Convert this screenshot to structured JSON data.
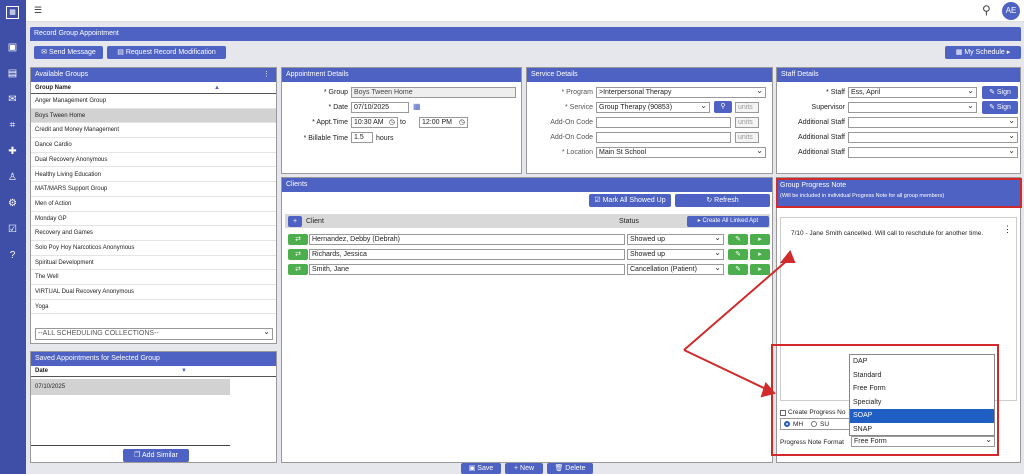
{
  "app": {
    "user_initials": "AE",
    "search_icon": "search-icon",
    "menu_icon": "menu-toggle-icon"
  },
  "page": {
    "title": "Record Group Appointment",
    "send_message": "Send Message",
    "request_modification": "Request Record Modification",
    "my_schedule": "My Schedule"
  },
  "available_groups": {
    "title": "Available Groups",
    "column": "Group Name",
    "items": [
      "Anger Management Group",
      "Boys Tween Home",
      "Credit and Money Management",
      "Dance Cardio",
      "Dual Recovery Anonymous",
      "Healthy Living Education",
      "MAT/MARS Support Group",
      "Men of Action",
      "Monday GP",
      "Recovery and Games",
      "Solo Poy Hoy Narcoticos Anonymous",
      "Spiritual Development",
      "The Well",
      "VIRTUAL Dual Recovery Anonymous",
      "Yoga"
    ],
    "selected": "Boys Tween Home",
    "collection": "--ALL SCHEDULING COLLECTIONS--"
  },
  "saved": {
    "title": "Saved Appointments for Selected Group",
    "column": "Date",
    "rows": [
      "07/10/2025"
    ],
    "add_similar": "Add Similar"
  },
  "appointment": {
    "title": "Appointment Details",
    "group_label": "* Group",
    "group_value": "Boys Tween Home",
    "date_label": "* Date",
    "date_value": "07/10/2025",
    "time_label": "* Appt.Time",
    "start": "10:30 AM",
    "to": "to",
    "end": "12:00 PM",
    "billable_label": "* Billable Time",
    "billable_value": "1.5",
    "hours": "hours"
  },
  "service": {
    "title": "Service Details",
    "program_label": "* Program",
    "program_value": ">Interpersonal Therapy",
    "service_label": "* Service",
    "service_value": "Group Therapy (90853)",
    "units": "units",
    "addon1_label": "Add-On Code",
    "addon2_label": "Add-On Code",
    "location_label": "* Location",
    "location_value": "Main St School"
  },
  "staff": {
    "title": "Staff Details",
    "staff_label": "* Staff",
    "staff_value": "Ess, April",
    "sign": "Sign",
    "supervisor_label": "Supervisor",
    "additional1": "Additional Staff",
    "additional2": "Additional Staff",
    "additional3": "Additional Staff"
  },
  "clients": {
    "title": "Clients",
    "mark_all": "Mark All Showed Up",
    "refresh": "Refresh",
    "col_client": "Client",
    "col_status": "Status",
    "create_linked": "Create All Linked Apt",
    "rows": [
      {
        "name": "Hernandez, Debby (Debrah)",
        "status": "Showed up"
      },
      {
        "name": "Richards, Jessica",
        "status": "Showed up"
      },
      {
        "name": "Smith, Jane",
        "status": "Cancellation (Patient)"
      }
    ]
  },
  "progress": {
    "title": "Group Progress Note",
    "subtitle": "(Will be included in individual Progress Note for all group members)",
    "note": "7/10 - Jane Smith cancelled. Will call to reschdule for another time.",
    "create_label": "Create Progress No",
    "mh": "MH",
    "su": "SU",
    "format_label": "Progress Note Format",
    "format_value": "Free Form",
    "options": [
      "DAP",
      "Standard",
      "Free Form",
      "Specialty",
      "SOAP",
      "SNAP"
    ],
    "highlighted": "SOAP"
  },
  "footer": {
    "save": "Save",
    "new": "New",
    "delete": "Delete"
  },
  "colors": {
    "primary": "#4e62c4",
    "rail": "#3f4fa8",
    "green": "#4cae4c",
    "annotation": "#d12a2a",
    "highlight": "#1f5fc4"
  }
}
